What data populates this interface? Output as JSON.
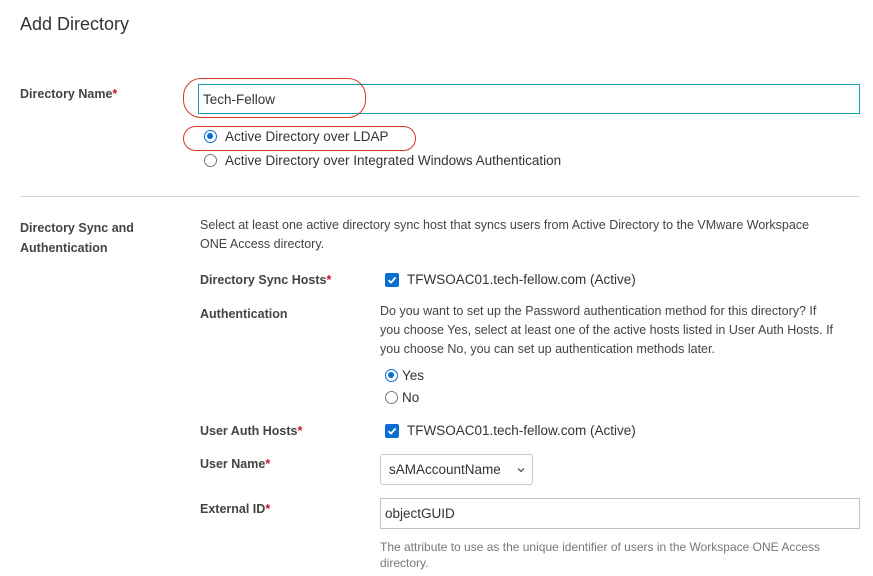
{
  "page": {
    "title": "Add Directory"
  },
  "directory_name": {
    "label": "Directory Name",
    "required_mark": "*",
    "value": "Tech-Fellow",
    "options": [
      {
        "label": "Active Directory over LDAP",
        "selected": true
      },
      {
        "label": "Active Directory over Integrated Windows Authentication",
        "selected": false
      }
    ]
  },
  "sync_section": {
    "label_line1": "Directory Sync and",
    "label_line2": "Authentication",
    "description_line1": "Select at least one active directory sync host that syncs users from Active Directory to the VMware Workspace",
    "description_line2": "ONE Access directory.",
    "sync_hosts": {
      "label": "Directory Sync Hosts",
      "required_mark": "*",
      "host": "TFWSOAC01.tech-fellow.com (Active)",
      "checked": true
    },
    "authentication": {
      "label": "Authentication",
      "question_line1": "Do you want to set up the Password authentication method for this directory? If",
      "question_line2": "you choose Yes, select at least one of the active hosts listed in User Auth Hosts. If",
      "question_line3": "you choose No, you can set up authentication methods later.",
      "yes_label": "Yes",
      "no_label": "No",
      "selected": "Yes"
    },
    "user_auth_hosts": {
      "label": "User Auth Hosts",
      "required_mark": "*",
      "host": "TFWSOAC01.tech-fellow.com (Active)",
      "checked": true
    },
    "user_name": {
      "label": "User Name",
      "required_mark": "*",
      "value": "sAMAccountName"
    },
    "external_id": {
      "label": "External ID",
      "required_mark": "*",
      "value": "objectGUID",
      "help_line1": "The attribute to use as the unique identifier of users in the Workspace ONE Access",
      "help_line2": "directory."
    }
  },
  "colors": {
    "accent": "#0a6ed1",
    "required": "#c8102e",
    "highlight": "#d6362a"
  }
}
